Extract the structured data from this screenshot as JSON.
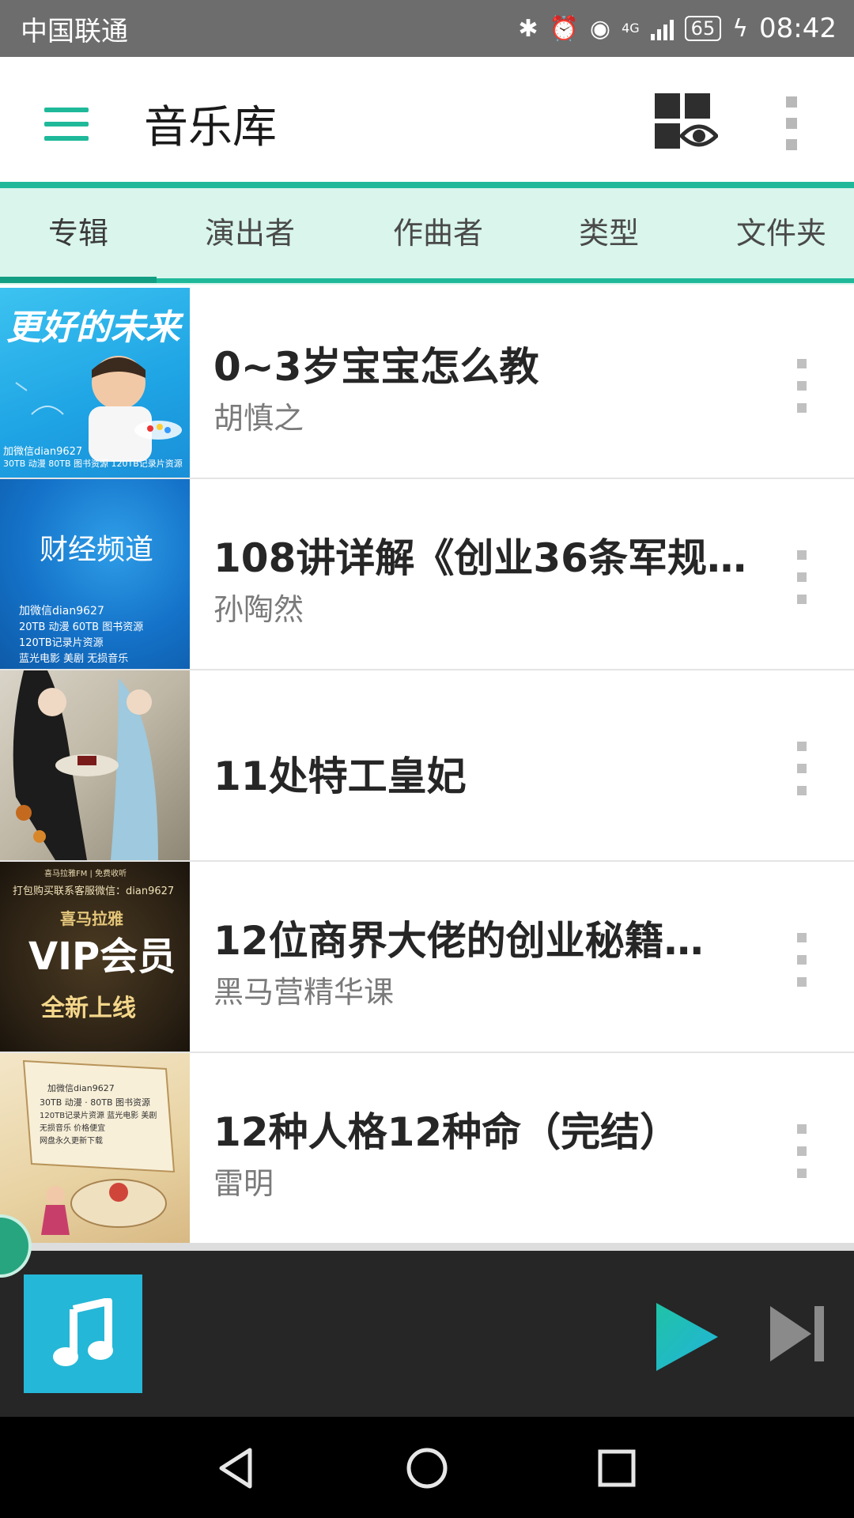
{
  "status_bar": {
    "carrier": "中国联通",
    "network": "4G",
    "battery": "65",
    "time": "08:42"
  },
  "app_bar": {
    "title": "音乐库",
    "accent_color": "#1fb99a"
  },
  "tabs": [
    {
      "label": "专辑",
      "selected": true
    },
    {
      "label": "演出者",
      "selected": false
    },
    {
      "label": "作曲者",
      "selected": false
    },
    {
      "label": "类型",
      "selected": false
    },
    {
      "label": "文件夹",
      "selected": false
    }
  ],
  "albums": [
    {
      "title": "0~3岁宝宝怎么教",
      "artist": "胡慎之",
      "cover": {
        "title": "更好的未来",
        "lines": [
          "加微信dian9627",
          "30TB 动漫  80TB 图书资源  120TB记录片资源"
        ]
      }
    },
    {
      "title": "108讲详解《创业36条军规…",
      "artist": "孙陶然",
      "cover": {
        "title": "财经频道",
        "lines": [
          "加微信dian9627",
          "20TB 动漫    60TB 图书资源",
          "120TB记录片资源",
          "蓝光电影 美剧 无损音乐"
        ]
      }
    },
    {
      "title": "11处特工皇妃",
      "artist": "",
      "cover": {
        "title": "",
        "lines": []
      }
    },
    {
      "title": "12位商界大佬的创业秘籍…",
      "artist": "黑马营精华课",
      "cover": {
        "title": "喜马拉雅",
        "top": "喜马拉雅FM | 免费收听",
        "contact": "打包购买联系客服微信：dian9627",
        "big": "VIP会员",
        "banner": "全新上线"
      }
    },
    {
      "title": "12种人格12种命（完结）",
      "artist": "雷明",
      "cover": {
        "title": "",
        "lines": [
          "加微信dian9627",
          "30TB 动漫 · 80TB 图书资源",
          "120TB记录片资源  蓝光电影 美剧",
          "无损音乐  价格便宜",
          "网盘永久更新下载"
        ]
      }
    }
  ],
  "icons": {
    "menu": "hamburger-icon",
    "view": "grid-eye-icon",
    "more": "more-vert-icon",
    "now_playing": "music-note-icon",
    "play": "play-icon",
    "next": "skip-next-icon"
  }
}
